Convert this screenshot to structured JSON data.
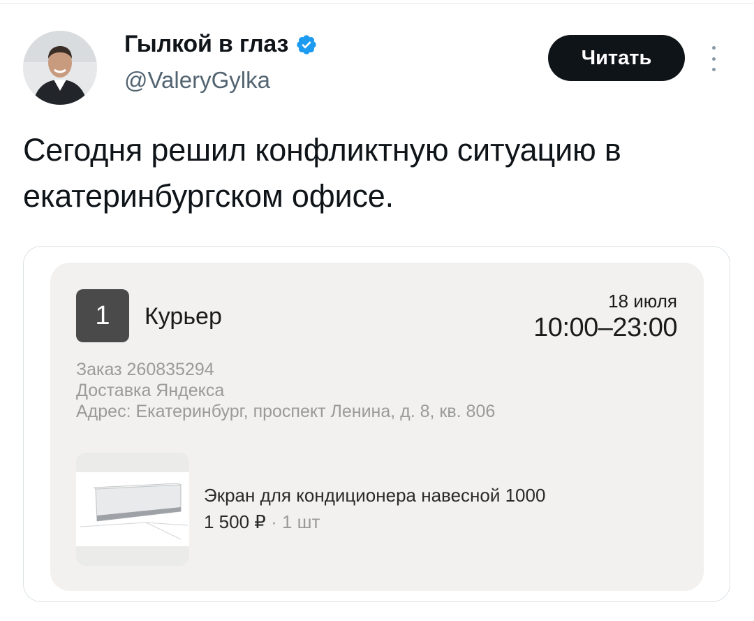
{
  "author": {
    "display_name": "Гылкой в глаз",
    "handle": "@ValeryGylka",
    "verified": true
  },
  "actions": {
    "follow_label": "Читать"
  },
  "tweet": {
    "text": "Сегодня решил конфликтную ситуацию в екатеринбургском офисе."
  },
  "order_card": {
    "step_number": "1",
    "delivery_type": "Курьер",
    "date": "18 июля",
    "time_window": "10:00–23:00",
    "order_line": "Заказ 260835294",
    "service_line": "Доставка Яндекса",
    "address_line": "Адрес: Екатеринбург, проспект Ленина, д. 8, кв. 806",
    "product": {
      "name": "Экран для кондиционера навесной 1000",
      "price": "1 500 ₽",
      "separator": "·",
      "quantity": "1 шт",
      "image_icon": "air-conditioner-image"
    }
  },
  "colors": {
    "button_bg": "#0f1419",
    "verified_blue": "#1d9bf0",
    "handle_gray": "#536471",
    "card_bg": "#f2f1ef"
  }
}
